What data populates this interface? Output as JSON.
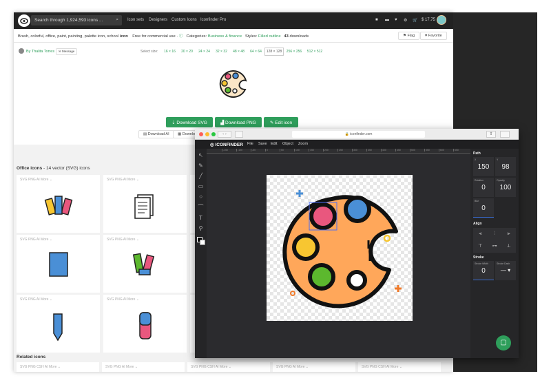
{
  "header": {
    "search_placeholder": "Search through 1,924,593 icons ...",
    "nav": [
      "Icon sets",
      "Designers",
      "Custom Icons",
      "Iconfinder Pro"
    ],
    "balance": "$ 17.75"
  },
  "info": {
    "tags": "Brush, colorful, office, paint, painting, palette icon, school",
    "tags_bold": "icon",
    "license": "Free for commercial use ·",
    "categories_label": "Categories:",
    "category": "Business & finance",
    "styles_label": "Styles:",
    "style": "Filled outline",
    "downloads_count": "43",
    "downloads_label": "downloads",
    "flag": "Flag",
    "favorite": "Favorite"
  },
  "author": {
    "name": "By Thalita Torres",
    "message": "Message",
    "select_size": "Select size:",
    "sizes": [
      "16 × 16",
      "20 × 20",
      "24 × 24",
      "32 × 32",
      "48 × 48",
      "64 × 64",
      "128 × 128",
      "256 × 256",
      "512 × 512"
    ],
    "selected_size": "128 × 128"
  },
  "downloads": {
    "svg": "Download SVG",
    "png": "Download PNG",
    "edit": "Edit icon",
    "ai": "Download AI",
    "other": "Download"
  },
  "office": {
    "title": "Office icons",
    "subtitle": "- 14 vector (SVG) icons",
    "formats": "SVG  PNG  AI  More ⌄"
  },
  "related": {
    "title": "Related icons",
    "formats": [
      "SVG  PNG  CSH  AI  More ⌄",
      "SVG  PNG  AI  More ⌄",
      "SVG  PNG  CSH  AI  More ⌄",
      "SVG  PNG  AI  More ⌄",
      "SVG  PNG  CSH  AI  More ⌄"
    ]
  },
  "editor": {
    "url": "iconfinder.com",
    "brand": "ICONFINDER",
    "menu": [
      "File",
      "Save",
      "Edit",
      "Object",
      "Zoom"
    ],
    "ruler": [
      "-150",
      "-100",
      "-50",
      "0",
      "50",
      "100",
      "150",
      "200",
      "250",
      "300",
      "350",
      "400",
      "450",
      "500",
      "550",
      "600",
      "650"
    ],
    "panel": {
      "path": "Path",
      "x_label": "X",
      "x": "150",
      "y_label": "Y",
      "y": "98",
      "rotation_label": "Rotation",
      "rotation": "0",
      "opacity_label": "Opacity",
      "opacity": "100",
      "blur_label": "Blur",
      "blur": "0",
      "align": "Align",
      "stroke": "Stroke",
      "stroke_width_label": "Stroke Width",
      "stroke_width": "0",
      "stroke_dash_label": "Stroke Dash"
    }
  },
  "colors": {
    "green": "#2e9e5b",
    "orange": "#ffa75a",
    "pink": "#e9577e",
    "blue": "#4a8fd6",
    "yellow": "#f7c631",
    "lime": "#5cb82e"
  }
}
